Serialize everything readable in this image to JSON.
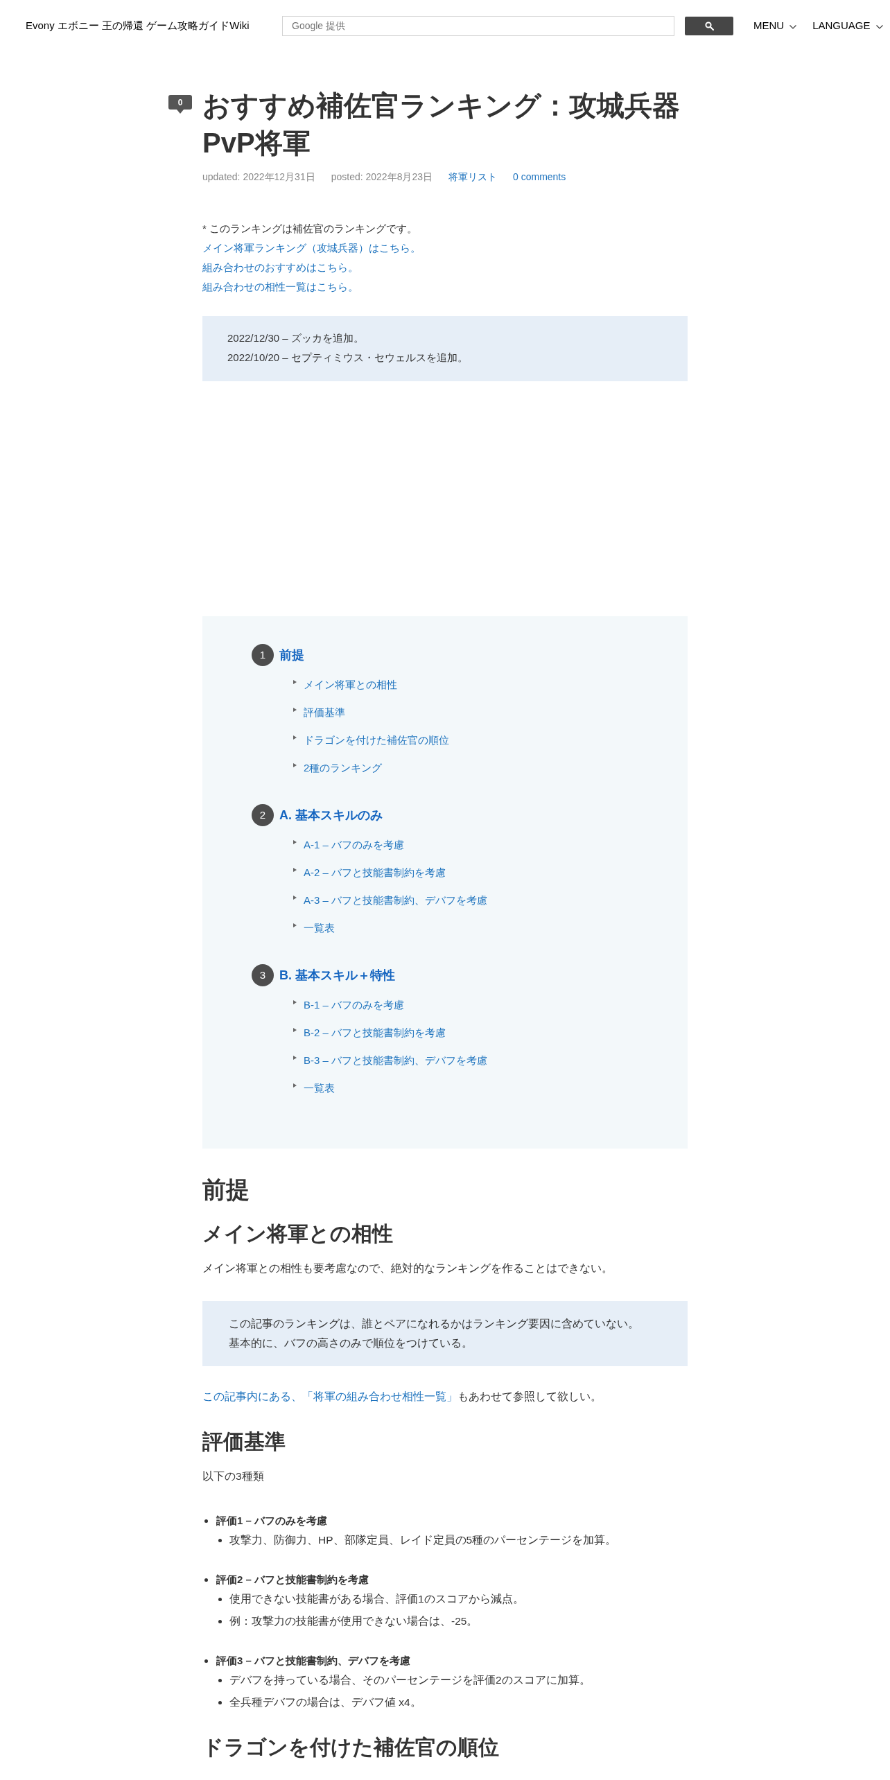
{
  "header": {
    "site_title": "Evony エボニー 王の帰還 ゲーム攻略ガイドWiki",
    "search": {
      "placeholder": "Google 提供"
    },
    "nav": [
      {
        "label": "MENU"
      },
      {
        "label": "LANGUAGE"
      }
    ]
  },
  "article": {
    "comment_count": "0",
    "title": "おすすめ補佐官ランキング：攻城兵器PvP将軍",
    "meta": [
      {
        "kind": "date",
        "text": "updated: 2022年12月31日"
      },
      {
        "kind": "date",
        "text": "posted: 2022年8月23日"
      },
      {
        "kind": "link",
        "text": "将軍リスト"
      },
      {
        "kind": "link",
        "text": "0 comments"
      }
    ],
    "intro": [
      {
        "kind": "text",
        "text": "* このランキングは補佐官のランキングです。"
      },
      {
        "kind": "link",
        "text": "メイン将軍ランキング（攻城兵器）はこちら。"
      },
      {
        "kind": "link",
        "text": "組み合わせのおすすめはこちら。"
      },
      {
        "kind": "link",
        "text": "組み合わせの相性一覧はこちら。"
      }
    ],
    "updates": [
      "2022/12/30 – ズッカを追加。",
      "2022/10/20 – セプティミウス・セウェルスを追加。"
    ]
  },
  "toc": [
    {
      "number": "1",
      "label": "前提",
      "children": [
        {
          "label": "メイン将軍との相性"
        },
        {
          "label": "評価基準"
        },
        {
          "label": "ドラゴンを付けた補佐官の順位"
        },
        {
          "label": "2種のランキング"
        }
      ]
    },
    {
      "number": "2",
      "label": "A. 基本スキルのみ",
      "children": [
        {
          "label": "A-1 – バフのみを考慮"
        },
        {
          "label": "A-2 – バフと技能書制約を考慮"
        },
        {
          "label": "A-3 – バフと技能書制約、デバフを考慮"
        },
        {
          "label": "一覧表"
        }
      ]
    },
    {
      "number": "3",
      "label": "B. 基本スキル＋特性",
      "children": [
        {
          "label": "B-1 – バフのみを考慮"
        },
        {
          "label": "B-2 – バフと技能書制約を考慮"
        },
        {
          "label": "B-3 – バフと技能書制約、デバフを考慮"
        },
        {
          "label": "一覧表"
        }
      ]
    }
  ],
  "content": [
    {
      "kind": "h2",
      "text": "前提"
    },
    {
      "kind": "h3",
      "text": "メイン将軍との相性"
    },
    {
      "kind": "paragraph",
      "text": "メイン将軍との相性も要考慮なので、絶対的なランキングを作ることはできない。"
    },
    {
      "kind": "note",
      "lines": [
        "この記事のランキングは、誰とペアになれるかはランキング要因に含めていない。",
        "基本的に、バフの高さのみで順位をつけている。"
      ]
    },
    {
      "kind": "link_paragraph",
      "link": "この記事内にある、「将軍の組み合わせ相性一覧」",
      "text": "もあわせて参照して欲しい。"
    },
    {
      "kind": "h3",
      "text": "評価基準"
    },
    {
      "kind": "paragraph",
      "text": "以下の3種類"
    },
    {
      "kind": "criteria",
      "items": [
        {
          "label": "評価1 – バフのみを考慮",
          "children": [
            {
              "text": "攻撃力、防御力、HP、部隊定員、レイド定員の5種のパーセンテージを加算。"
            }
          ]
        },
        {
          "label": "評価2 – バフと技能書制約を考慮",
          "children": [
            {
              "text": "使用できない技能書がある場合、評価1のスコアから減点。"
            },
            {
              "text": "例：攻撃力の技能書が使用できない場合は、-25。"
            }
          ]
        },
        {
          "label": "評価3 – バフと技能書制約、デバフを考慮",
          "children": [
            {
              "text": "デバフを持っている場合、そのパーセンテージを評価2のスコアに加算。"
            },
            {
              "text": "全兵種デバフの場合は、デバフ値 x4。"
            }
          ]
        }
      ]
    },
    {
      "kind": "h3",
      "text": "ドラゴンを付けた補佐官の順位"
    }
  ]
}
